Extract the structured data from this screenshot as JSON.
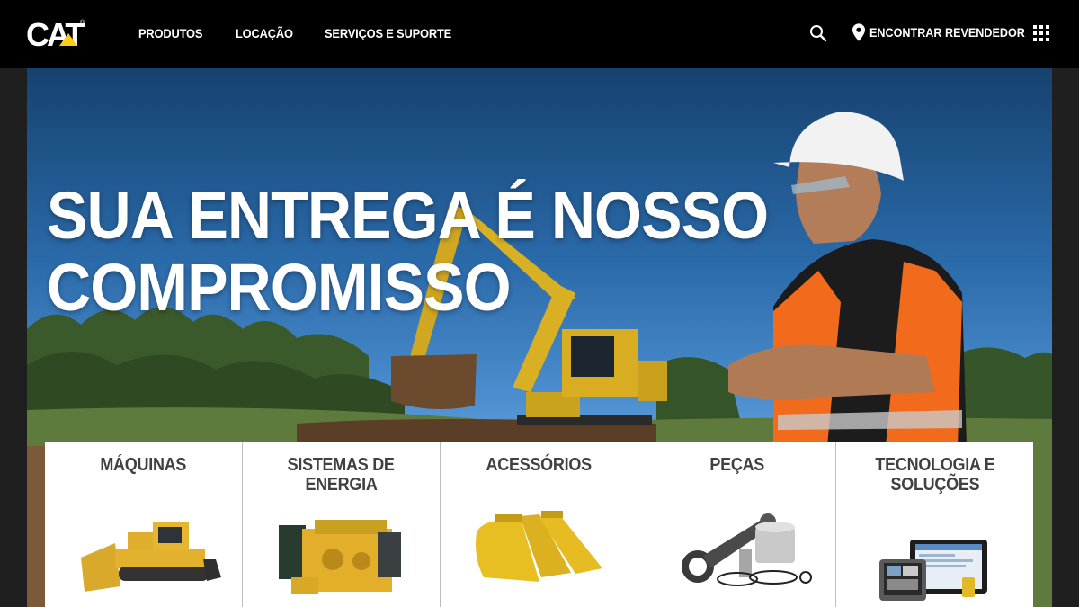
{
  "brand": {
    "logo_text": "CAT",
    "registered_mark": "®",
    "accent_color": "#FFCD11"
  },
  "nav": {
    "items": [
      {
        "label": "PRODUTOS"
      },
      {
        "label": "LOCAÇÃO"
      },
      {
        "label": "SERVIÇOS E SUPORTE"
      }
    ],
    "search_icon": "search-icon",
    "dealer_label": "ENCONTRAR REVENDEDOR",
    "dealer_icon": "map-pin-icon",
    "apps_icon": "grid-icon"
  },
  "hero": {
    "headline_line1": "SUA ENTREGA É NOSSO",
    "headline_line2": "COMPROMISSO"
  },
  "categories": [
    {
      "line1": "MÁQUINAS",
      "line2": "",
      "icon": "bulldozer-image"
    },
    {
      "line1": "SISTEMAS DE",
      "line2": "ENERGIA",
      "icon": "engine-image"
    },
    {
      "line1": "ACESSÓRIOS",
      "line2": "",
      "icon": "buckets-image"
    },
    {
      "line1": "PEÇAS",
      "line2": "",
      "icon": "piston-image"
    },
    {
      "line1": "TECNOLOGIA E",
      "line2": "SOLUÇÕES",
      "icon": "tablets-image"
    }
  ]
}
